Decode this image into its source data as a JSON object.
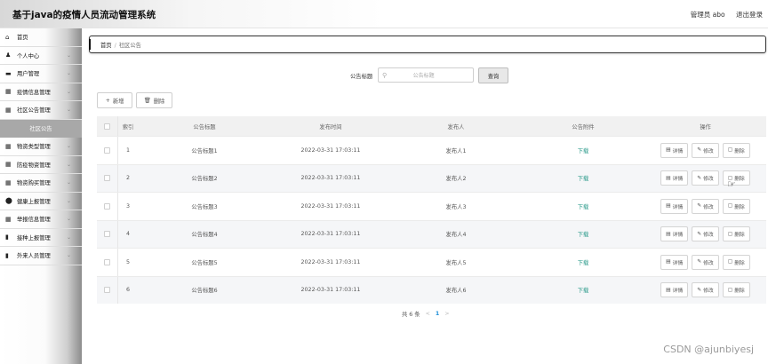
{
  "header": {
    "app_title": "基于java的疫情人员流动管理系统",
    "user_label": "管理员 abo",
    "logout_label": "退出登录"
  },
  "sidebar": {
    "items": [
      {
        "label": "首页",
        "icon": "home-icon",
        "glyph": "⌂",
        "chevron": false
      },
      {
        "label": "个人中心",
        "icon": "user-icon",
        "glyph": "♟",
        "chevron": true
      },
      {
        "label": "用户管理",
        "icon": "monitor-icon",
        "glyph": "▬",
        "chevron": true
      },
      {
        "label": "疫情信息管理",
        "icon": "grid-icon",
        "glyph": "▦",
        "chevron": true
      },
      {
        "label": "社区公告管理",
        "icon": "grid-icon",
        "glyph": "▦",
        "chevron": true
      },
      {
        "label": "社区公告",
        "icon": "",
        "glyph": "",
        "chevron": false,
        "sub": true
      },
      {
        "label": "物资类型管理",
        "icon": "grid-icon",
        "glyph": "▦",
        "chevron": true
      },
      {
        "label": "防疫物资管理",
        "icon": "grid-icon",
        "glyph": "▦",
        "chevron": true
      },
      {
        "label": "物资购买管理",
        "icon": "grid-icon",
        "glyph": "▦",
        "chevron": true
      },
      {
        "label": "健康上报管理",
        "icon": "location-icon",
        "glyph": "⬤",
        "chevron": true
      },
      {
        "label": "举报信息管理",
        "icon": "grid-icon",
        "glyph": "▦",
        "chevron": true
      },
      {
        "label": "接种上报管理",
        "icon": "file-icon",
        "glyph": "▮",
        "chevron": true
      },
      {
        "label": "外来人员管理",
        "icon": "file-icon",
        "glyph": "▮",
        "chevron": true
      }
    ]
  },
  "breadcrumb": {
    "home": "首页",
    "separator": "/",
    "current": "社区公告"
  },
  "search": {
    "label": "公告标题",
    "placeholder": "公告标题",
    "button": "查询"
  },
  "actions": {
    "add": "新增",
    "delete": "删除"
  },
  "table": {
    "columns": [
      "索引",
      "公告标题",
      "发布时间",
      "发布人",
      "公告附件",
      "操作"
    ],
    "rows": [
      {
        "index": "1",
        "title": "公告标题1",
        "time": "2022-03-31 17:03:11",
        "publisher": "发布人1",
        "attachment": "下载"
      },
      {
        "index": "2",
        "title": "公告标题2",
        "time": "2022-03-31 17:03:11",
        "publisher": "发布人2",
        "attachment": "下载"
      },
      {
        "index": "3",
        "title": "公告标题3",
        "time": "2022-03-31 17:03:11",
        "publisher": "发布人3",
        "attachment": "下载"
      },
      {
        "index": "4",
        "title": "公告标题4",
        "time": "2022-03-31 17:03:11",
        "publisher": "发布人4",
        "attachment": "下载"
      },
      {
        "index": "5",
        "title": "公告标题5",
        "time": "2022-03-31 17:03:11",
        "publisher": "发布人5",
        "attachment": "下载"
      },
      {
        "index": "6",
        "title": "公告标题6",
        "time": "2022-03-31 17:03:11",
        "publisher": "发布人6",
        "attachment": "下载"
      }
    ],
    "row_actions": {
      "detail": "详情",
      "edit": "修改",
      "delete": "删除"
    }
  },
  "pagination": {
    "total": "共 6 条",
    "prev": "<",
    "page": "1",
    "next": ">"
  },
  "watermark": "CSDN @ajunbiyesj",
  "colors": {
    "accent_link": "#2a9a8a",
    "active_page": "#1e8fd8",
    "sidebar_active": "#a8a8a8"
  }
}
